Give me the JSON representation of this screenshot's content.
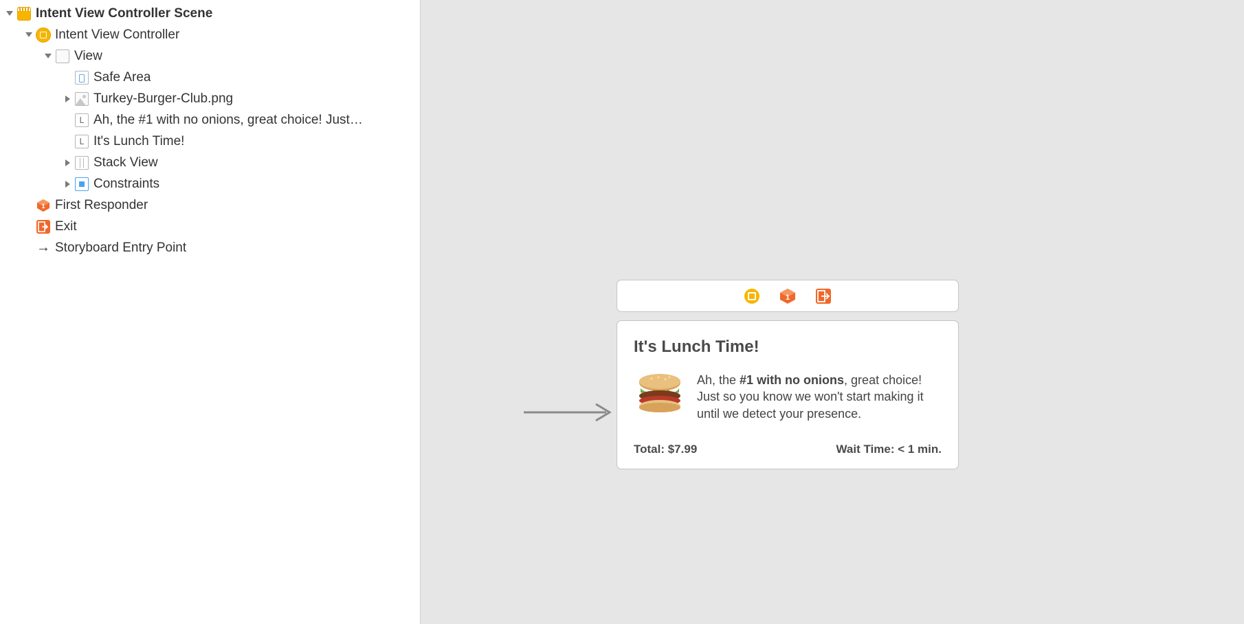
{
  "outline": {
    "scene_label": "Intent View Controller Scene",
    "vc_label": "Intent View Controller",
    "view_label": "View",
    "safe_area_label": "Safe Area",
    "image_label": "Turkey-Burger-Club.png",
    "label1_text": "Ah, the #1 with no onions, great choice! Just…",
    "label2_text": "It's Lunch Time!",
    "stack_label": "Stack View",
    "constraints_label": "Constraints",
    "first_responder_label": "First Responder",
    "exit_label": "Exit",
    "entry_label": "Storyboard Entry Point"
  },
  "preview": {
    "title": "It's Lunch Time!",
    "body_prefix": "Ah, the ",
    "body_emph": "#1 with no onions",
    "body_suffix": ", great choice! Just so you know we won't start making it until we detect your presence.",
    "total_label": "Total: $7.99",
    "wait_label": "Wait Time: < 1 min."
  }
}
